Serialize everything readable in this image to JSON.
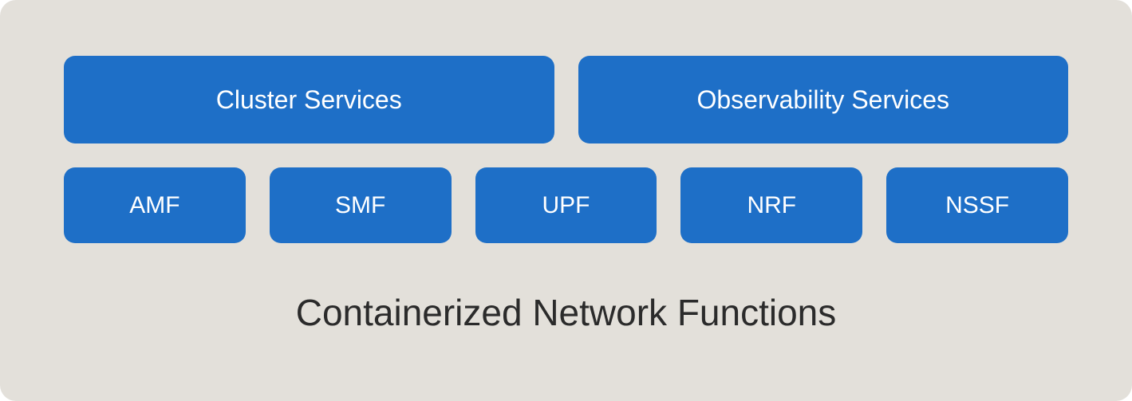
{
  "top_row": [
    {
      "label": "Cluster Services",
      "id": "cluster-services"
    },
    {
      "label": "Observability Services",
      "id": "observability-services"
    }
  ],
  "bottom_row": [
    {
      "label": "AMF",
      "id": "amf"
    },
    {
      "label": "SMF",
      "id": "smf"
    },
    {
      "label": "UPF",
      "id": "upf"
    },
    {
      "label": "NRF",
      "id": "nrf"
    },
    {
      "label": "NSSF",
      "id": "nssf"
    }
  ],
  "title": "Containerized Network Functions",
  "colors": {
    "box_bg": "#1e6fc7",
    "box_text": "#ffffff",
    "container_bg": "#e3e0da",
    "title_text": "#2b2b2b"
  }
}
